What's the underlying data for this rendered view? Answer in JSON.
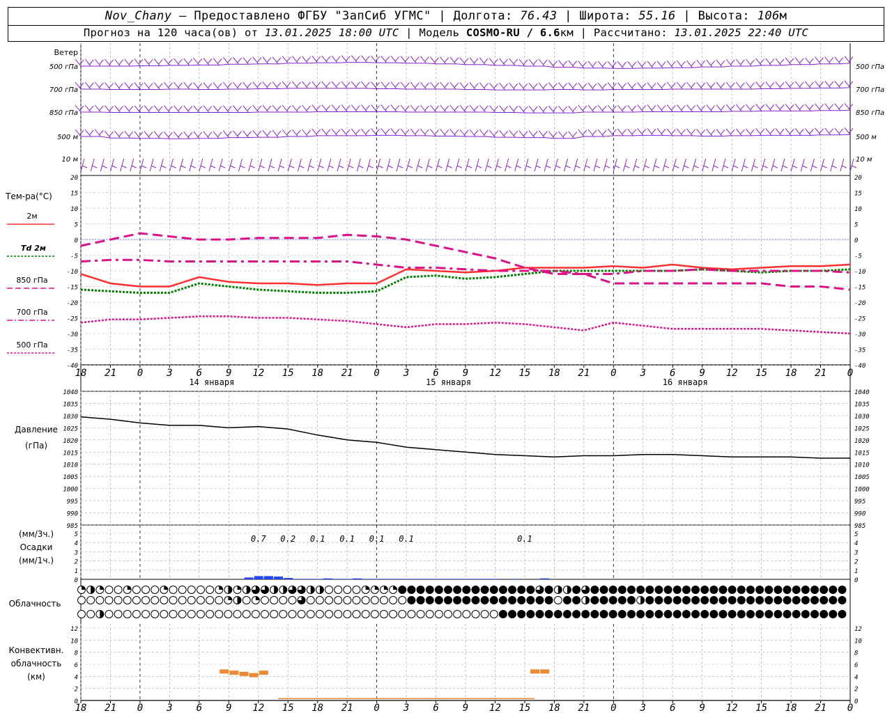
{
  "header": {
    "station": "Nov_Chany",
    "provider": "— Предоставлено ФГБУ \"ЗапСиб УГМС\"",
    "lon_label": "Долгота:",
    "lon": "76.43",
    "lat_label": "Широта:",
    "lat": "55.16",
    "alt_label": "Высота:",
    "alt": "106",
    "alt_unit": "м",
    "forecast_label": "Прогноз на 120 часа(ов) от",
    "forecast_time": "13.01.2025 18:00 UTC",
    "model_label": "Модель",
    "model": "COSMO-RU / 6.6",
    "model_unit": "км",
    "calc_label": "Рассчитано:",
    "calc_time": "13.01.2025 22:40 UTC"
  },
  "colors": {
    "t2m": "#ff3030",
    "td2m": "#008000",
    "t850": "#dd1188",
    "t700": "#dd1188",
    "t500": "#dd1188",
    "wind": "#8822cc",
    "pressure": "#000000",
    "precip": "#2244ff",
    "conv": "#ee8833",
    "grid": "#aaaaaa"
  },
  "time_axis": {
    "ticks": [
      "18",
      "21",
      "0",
      "3",
      "6",
      "9",
      "12",
      "15",
      "18",
      "21",
      "0",
      "3",
      "6",
      "9",
      "12",
      "15",
      "18",
      "21",
      "0",
      "3",
      "6",
      "9",
      "12",
      "15",
      "18",
      "21",
      "0"
    ],
    "days": [
      "14 января",
      "15 января",
      "16 января"
    ]
  },
  "wind_panel": {
    "title": "Ветер",
    "levels": [
      "500 гПа",
      "700 гПа",
      "850 гПа",
      "500 м",
      "10  м"
    ]
  },
  "temp_panel": {
    "title": "Тем-ра(°C)",
    "legend": [
      "2м",
      "Td 2м",
      "850 гПа",
      "700 гПа",
      "500 гПа"
    ],
    "yticks": [
      "20",
      "15",
      "10",
      "5",
      "0",
      "-5",
      "-10",
      "-15",
      "-20",
      "-25",
      "-30",
      "-35",
      "-40"
    ]
  },
  "pressure_panel": {
    "title1": "Давление",
    "title2": "(гПа)",
    "yticks": [
      "1040",
      "1035",
      "1030",
      "1025",
      "1020",
      "1015",
      "1010",
      "1005",
      "1000",
      "995",
      "990",
      "985"
    ]
  },
  "precip_panel": {
    "unit1": "(мм/3ч.)",
    "title": "Осадки",
    "unit2": "(мм/1ч.)",
    "yticks": [
      "5",
      "4",
      "3",
      "2",
      "1",
      "0"
    ],
    "labels": [
      {
        "h": 18,
        "text": "0.7"
      },
      {
        "h": 21,
        "text": "0.2"
      },
      {
        "h": 24,
        "text": "0.1"
      },
      {
        "h": 27,
        "text": "0.1"
      },
      {
        "h": 30,
        "text": "0.1"
      },
      {
        "h": 33,
        "text": "0.1"
      },
      {
        "h": 45,
        "text": "0.1"
      }
    ]
  },
  "cloud_panel": {
    "title": "Облачность"
  },
  "conv_panel": {
    "title": [
      "Конвективн.",
      "облачность",
      "(км)"
    ],
    "yticks": [
      "12",
      "10",
      "8",
      "6",
      "4",
      "2",
      "0"
    ]
  },
  "chart_data": {
    "type": "line",
    "x_hours": [
      0,
      3,
      6,
      9,
      12,
      15,
      18,
      21,
      24,
      27,
      30,
      33,
      36,
      39,
      42,
      45,
      48,
      51,
      54,
      57,
      60,
      63,
      66,
      69,
      72,
      75,
      78
    ],
    "temperature": {
      "ylim": [
        -40,
        20
      ],
      "series": [
        {
          "name": "2м",
          "values": [
            -11,
            -14,
            -15,
            -15,
            -12,
            -13.5,
            -14,
            -14,
            -14.5,
            -14,
            -14,
            -9.5,
            -10,
            -10.5,
            -10,
            -9,
            -9,
            -9,
            -8.5,
            -9,
            -8,
            -9,
            -9.5,
            -9,
            -8.5,
            -8.5,
            -8
          ]
        },
        {
          "name": "Td 2м",
          "values": [
            -16,
            -16.5,
            -17,
            -17,
            -14,
            -15,
            -16,
            -16.5,
            -17,
            -17,
            -16.5,
            -12,
            -11.5,
            -12.5,
            -12,
            -11,
            -10,
            -10,
            -10,
            -10,
            -10,
            -9.5,
            -10,
            -10.5,
            -10,
            -10,
            -9.5
          ]
        },
        {
          "name": "850 гПа",
          "values": [
            -2,
            0,
            2,
            1,
            0,
            0,
            0.5,
            0.5,
            0.5,
            1.5,
            1,
            0,
            -2,
            -4,
            -6,
            -9,
            -11,
            -11,
            -14,
            -14,
            -14,
            -14,
            -14,
            -14,
            -15,
            -15,
            -16
          ]
        },
        {
          "name": "700 гПа",
          "values": [
            -7,
            -6.5,
            -6.5,
            -7,
            -7,
            -7,
            -7,
            -7,
            -7,
            -7,
            -8,
            -9,
            -9,
            -9.5,
            -10,
            -10,
            -10,
            -11,
            -11,
            -10,
            -10,
            -9.5,
            -10,
            -10,
            -10,
            -10,
            -10.5
          ]
        },
        {
          "name": "500 гПа",
          "values": [
            -26.5,
            -25.5,
            -25.5,
            -25,
            -24.5,
            -24.5,
            -25,
            -25,
            -25.5,
            -26,
            -27,
            -28,
            -27,
            -27,
            -26.5,
            -27,
            -28,
            -29,
            -26.5,
            -27.5,
            -28.5,
            -28.5,
            -28.5,
            -28.5,
            -29,
            -29.5,
            -30
          ]
        }
      ]
    },
    "pressure": {
      "ylim": [
        985,
        1040
      ],
      "values": [
        1029.5,
        1028.5,
        1027,
        1026,
        1026,
        1025,
        1025.5,
        1024.5,
        1022,
        1020,
        1019,
        1017,
        1016,
        1015,
        1014,
        1013.5,
        1013,
        1013.5,
        1013.5,
        1014,
        1014,
        1013.5,
        1013,
        1013,
        1013,
        1012.5,
        1012.5
      ]
    },
    "precip": {
      "ylim": [
        0,
        5
      ],
      "bars": [
        {
          "h": 17,
          "v": 0.2
        },
        {
          "h": 18,
          "v": 0.35
        },
        {
          "h": 19,
          "v": 0.35
        },
        {
          "h": 20,
          "v": 0.3
        },
        {
          "h": 21,
          "v": 0.15
        },
        {
          "h": 22,
          "v": 0.05
        },
        {
          "h": 23,
          "v": 0.05
        },
        {
          "h": 24,
          "v": 0.05
        },
        {
          "h": 25,
          "v": 0.1
        },
        {
          "h": 26,
          "v": 0.05
        },
        {
          "h": 27,
          "v": 0.05
        },
        {
          "h": 28,
          "v": 0.1
        },
        {
          "h": 29,
          "v": 0.05
        },
        {
          "h": 30,
          "v": 0.05
        },
        {
          "h": 31,
          "v": 0.05
        },
        {
          "h": 32,
          "v": 0.05
        },
        {
          "h": 33,
          "v": 0.05
        },
        {
          "h": 34,
          "v": 0.05
        },
        {
          "h": 35,
          "v": 0.05
        },
        {
          "h": 36,
          "v": 0.05
        },
        {
          "h": 37,
          "v": 0.05
        },
        {
          "h": 38,
          "v": 0.05
        },
        {
          "h": 39,
          "v": 0.05
        },
        {
          "h": 40,
          "v": 0.05
        },
        {
          "h": 41,
          "v": 0.05
        },
        {
          "h": 42,
          "v": 0.05
        },
        {
          "h": 44,
          "v": 0.05
        },
        {
          "h": 47,
          "v": 0.1
        }
      ]
    },
    "clouds": {
      "rows": [
        "121001000100000121233223322000011114444444444444443422434444444444444444444444444444",
        "000000000000000012010000300000000000444444444444444404424444424444444444444444444444",
        "002000000000000000000000000000000000000000000044444444444444444444444444444444444444"
      ]
    },
    "convective": {
      "ylim": [
        0,
        12
      ],
      "tops": [
        {
          "h": 14.5,
          "v": 4.8
        },
        {
          "h": 15.5,
          "v": 4.6
        },
        {
          "h": 16.5,
          "v": 4.4
        },
        {
          "h": 17.5,
          "v": 4.2
        },
        {
          "h": 18.5,
          "v": 4.6
        },
        {
          "h": 46,
          "v": 4.8
        },
        {
          "h": 47,
          "v": 4.8
        }
      ],
      "base_value": 0.3
    }
  }
}
